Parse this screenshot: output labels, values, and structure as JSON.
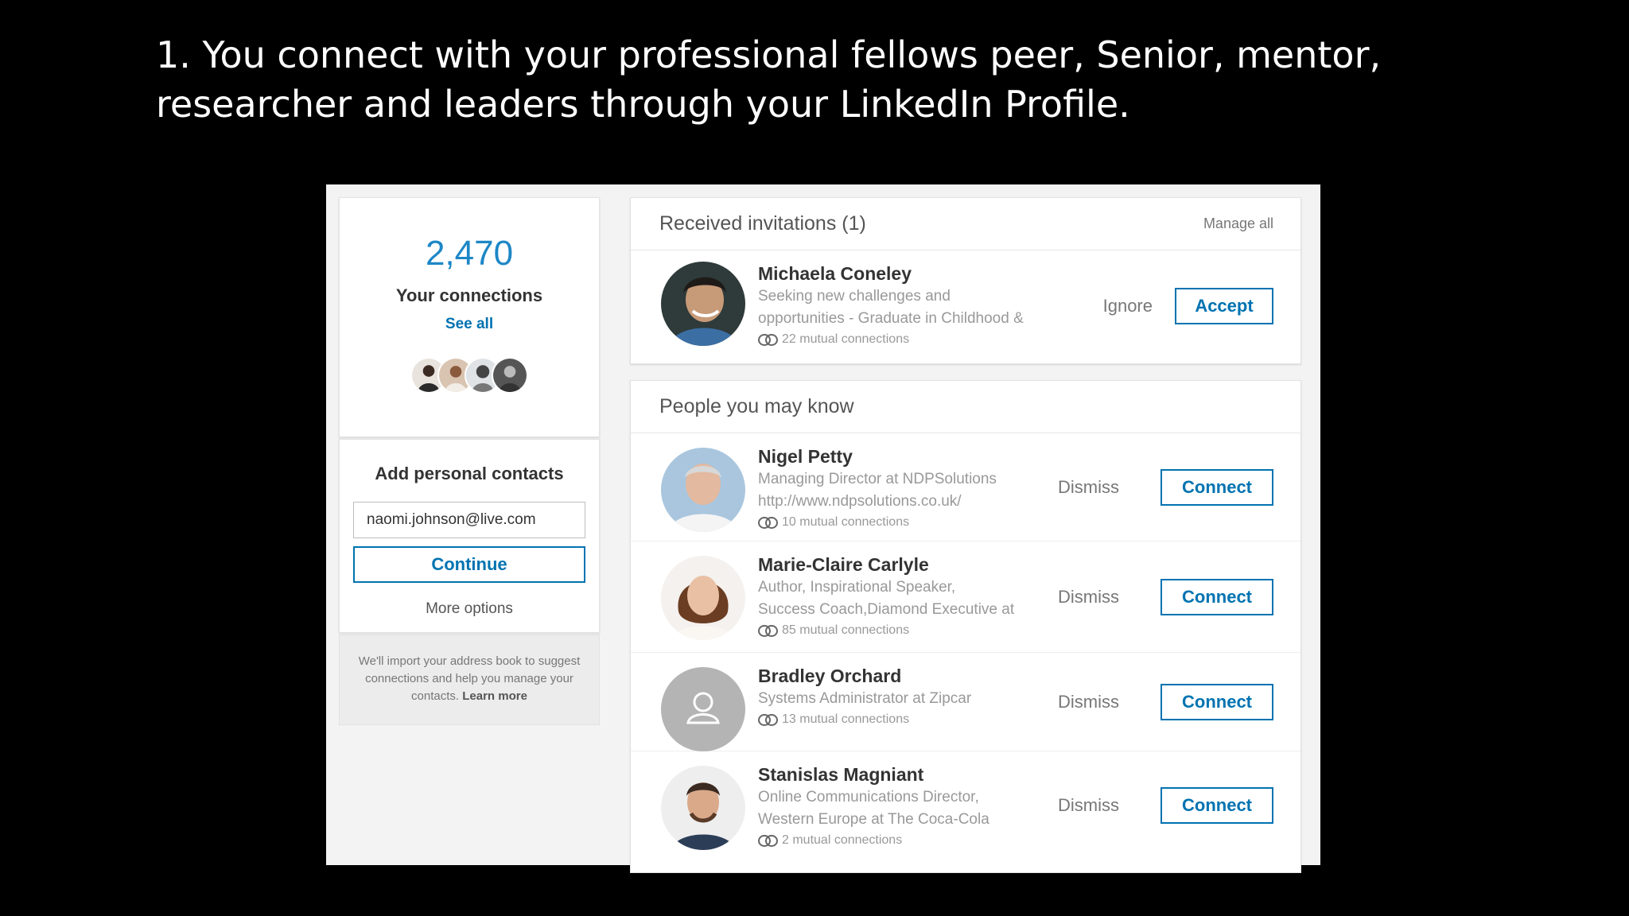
{
  "slide": {
    "title_line1": "1. You connect with your professional fellows peer, Senior, mentor,",
    "title_line2": "researcher and leaders through your LinkedIn Profile."
  },
  "connections": {
    "count": "2,470",
    "label": "Your connections",
    "see_all": "See all"
  },
  "contacts": {
    "title": "Add personal contacts",
    "email_value": "naomi.johnson@live.com",
    "continue_label": "Continue",
    "more_options": "More options",
    "note": "We'll import your address book to suggest connections and help you manage your contacts.",
    "learn_more": "Learn more"
  },
  "invitations": {
    "header": "Received invitations (1)",
    "manage_all": "Manage all",
    "items": [
      {
        "name": "Michaela Coneley",
        "headline1": "Seeking new challenges and",
        "headline2": "opportunities - Graduate in Childhood &",
        "mutual": "22 mutual connections",
        "ignore": "Ignore",
        "accept": "Accept"
      }
    ]
  },
  "pymk": {
    "header": "People you may know",
    "items": [
      {
        "name": "Nigel Petty",
        "headline1": "Managing Director at NDPSolutions",
        "headline2": "http://www.ndpsolutions.co.uk/",
        "mutual": "10 mutual connections",
        "dismiss": "Dismiss",
        "connect": "Connect"
      },
      {
        "name": "Marie-Claire Carlyle",
        "headline1": "Author, Inspirational Speaker,",
        "headline2": "Success Coach,Diamond Executive at",
        "mutual": "85 mutual connections",
        "dismiss": "Dismiss",
        "connect": "Connect"
      },
      {
        "name": "Bradley Orchard",
        "headline1": "Systems Administrator at Zipcar",
        "mutual": "13 mutual connections",
        "dismiss": "Dismiss",
        "connect": "Connect"
      },
      {
        "name": "Stanislas Magniant",
        "headline1": "Online Communications Director,",
        "headline2": "Western Europe at The Coca-Cola",
        "mutual": "2 mutual connections",
        "dismiss": "Dismiss",
        "connect": "Connect"
      }
    ]
  },
  "icons": {
    "mutual": "mutual-connections-icon",
    "placeholder_avatar": "user-silhouette-icon"
  },
  "colors": {
    "accent": "#0073b1",
    "count": "#1d87c6",
    "background": "#000000",
    "panel": "#ffffff"
  }
}
